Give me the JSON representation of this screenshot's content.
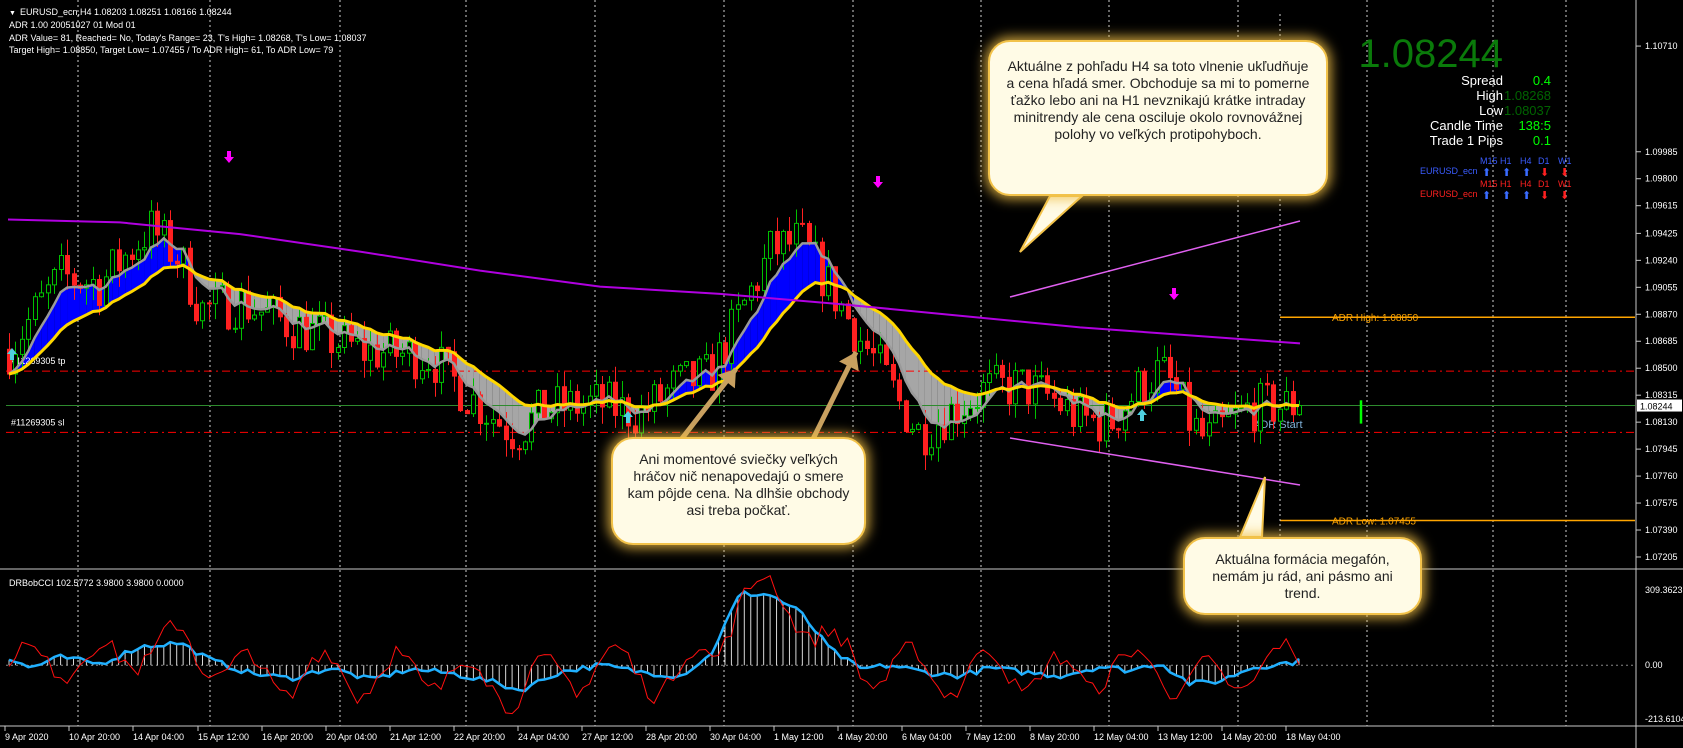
{
  "header": {
    "title": "EURUSD_ecn,H4  1.08203 1.08251 1.08166 1.08244",
    "line2": "ADR 1.00 20051027 01 Mod 01",
    "line3": "ADR Value= 81, Reached= No, Today's Range= 23, T's High= 1.08268, T's Low= 1.08037",
    "line4": "Target High= 1.08850, Target Low= 1.07455 / To ADR High= 61, To ADR Low= 79"
  },
  "info_panel": {
    "price": "1.08244",
    "rows": [
      {
        "label": "Spread",
        "value": "0.4",
        "color": "#00ff00"
      },
      {
        "label": "High",
        "value": "1.08268",
        "color": "#006400"
      },
      {
        "label": "Low",
        "value": "1.08037",
        "color": "#006400"
      },
      {
        "label": "Candle Time",
        "value": "138:5",
        "color": "#00ff00"
      },
      {
        "label": "Trade 1 Pips",
        "value": "0.1",
        "color": "#00ff00"
      }
    ],
    "mtf_timeframes": [
      "M15",
      "H1",
      "H4",
      "D1",
      "W1"
    ],
    "mtf_symbol": "EURUSD_ecn",
    "mtf_row1_color": "#3a5cff",
    "mtf_row2_color": "#ff2020"
  },
  "annotations": {
    "bubble_top": "Aktuálne z pohľadu H4 sa toto vlnenie ukľudňuje a cena hľadá smer. Obchoduje sa mi to pomerne ťažko lebo ani na H1 nevznikajú krátke intraday minitrendy ale cena osciluje okolo rovnovážnej polohy vo veľkých protipohyboch.",
    "bubble_mid": "Ani momentové sviečky veľkých hráčov nič nenapovedajú o smere kam pôjde cena. Na dlhšie obchody asi treba počkať.",
    "bubble_right": "Aktuálna formácia megafón, nemám ju rád, ani pásmo ani trend."
  },
  "chart_data": [
    {
      "type": "candlestick",
      "symbol": "EURUSD_ecn",
      "timeframe": "H4",
      "ohlc": {
        "open": 1.08203,
        "high": 1.08251,
        "low": 1.08166,
        "close": 1.08244
      },
      "current_price": "1.08244",
      "y_ticks": [
        "1.10710",
        "1.09985",
        "1.09800",
        "1.09615",
        "1.09425",
        "1.09240",
        "1.09055",
        "1.08870",
        "1.08685",
        "1.08500",
        "1.08315",
        "1.08130",
        "1.07945",
        "1.07760",
        "1.07575",
        "1.07390",
        "1.07205"
      ],
      "x_ticks": [
        "9 Apr 2020",
        "10 Apr 20:00",
        "14 Apr 04:00",
        "15 Apr 12:00",
        "16 Apr 20:00",
        "20 Apr 04:00",
        "21 Apr 12:00",
        "22 Apr 20:00",
        "24 Apr 04:00",
        "27 Apr 12:00",
        "28 Apr 20:00",
        "30 Apr 04:00",
        "1 May 12:00",
        "4 May 20:00",
        "6 May 04:00",
        "7 May 12:00",
        "8 May 20:00",
        "12 May 04:00",
        "13 May 12:00",
        "14 May 20:00",
        "18 May 04:00"
      ],
      "levels": [
        {
          "name": "ADR High",
          "label": "ADR High: 1.08850",
          "value": 1.0885,
          "color": "#ffa500"
        },
        {
          "name": "ADR Low",
          "label": "ADR Low: 1.07455",
          "value": 1.07455,
          "color": "#ffa500"
        },
        {
          "name": "tp",
          "label": "#11269305 tp",
          "value": 1.0848,
          "color": "#ff0000"
        },
        {
          "name": "sl",
          "label": "#11269305 sl",
          "value": 1.0806,
          "color": "#ff0000"
        }
      ],
      "adr_start_label": "ADR Start",
      "colors": {
        "bull": "#00c000",
        "bear": "#ff2020",
        "band_fill_up": "#0000ff",
        "band_fill_dn": "#a6a6a6",
        "ma_fast": "#ffd700",
        "ma_slow": "#b000e0",
        "channel": "#e060f0"
      }
    },
    {
      "type": "line",
      "name": "DRBobCCI",
      "header": "DRBobCCI 102.5772 3.9800 3.9800 0.0000",
      "y_ticks": [
        "309.3623",
        "0.00",
        "-213.6104"
      ],
      "ylim": [
        -213.6104,
        309.3623
      ],
      "colors": {
        "cci": "#20b0ff",
        "signal": "#ff1010",
        "hist": "#ffffff"
      }
    }
  ]
}
